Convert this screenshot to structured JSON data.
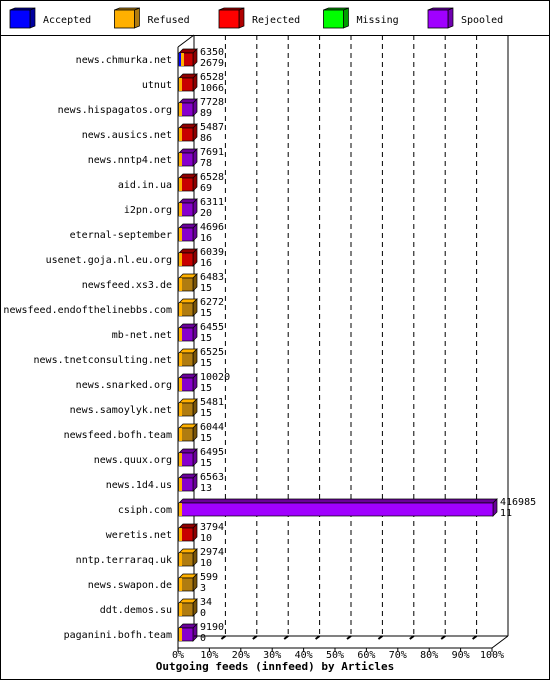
{
  "colors": {
    "accepted": "#0000ff",
    "refused": "#ffb000",
    "refused_dark": "#b07c10",
    "rejected": "#c80000",
    "missing": "#00ff00",
    "spooled": "#8800cc"
  },
  "legend": [
    {
      "key": "accepted",
      "label": "Accepted",
      "color": "#0000ff",
      "side": "#0000a0"
    },
    {
      "key": "refused",
      "label": "Refused",
      "color": "#ffb000",
      "side": "#b07c10"
    },
    {
      "key": "rejected",
      "label": "Rejected",
      "color": "#ff0000",
      "side": "#b00000"
    },
    {
      "key": "missing",
      "label": "Missing",
      "color": "#00ff00",
      "side": "#00a000"
    },
    {
      "key": "spooled",
      "label": "Spooled",
      "color": "#a000ff",
      "side": "#7000b0"
    }
  ],
  "chart_data": {
    "type": "bar",
    "orientation": "horizontal",
    "stacked": true,
    "title": "Outgoing feeds (innfeed) by Articles",
    "x_ticks": [
      "0%",
      "10%",
      "20%",
      "30%",
      "40%",
      "50%",
      "60%",
      "70%",
      "80%",
      "90%",
      "100%"
    ],
    "xlim": [
      0,
      100
    ],
    "grid": true,
    "legend_position": "top",
    "max_offered": 416985,
    "categories": [
      "news.chmurka.net",
      "utnut",
      "news.hispagatos.org",
      "news.ausics.net",
      "news.nntp4.net",
      "aid.in.ua",
      "i2pn.org",
      "eternal-september",
      "usenet.goja.nl.eu.org",
      "newsfeed.xs3.de",
      "newsfeed.endofthelinebbs.com",
      "mb-net.net",
      "news.tnetconsulting.net",
      "news.snarked.org",
      "news.samoylyk.net",
      "newsfeed.bofh.team",
      "news.quux.org",
      "news.1d4.us",
      "csiph.com",
      "weretis.net",
      "nntp.terraraq.uk",
      "news.swapon.de",
      "ddt.demos.su",
      "paganini.bofh.team"
    ],
    "offered": [
      6350,
      6528,
      7728,
      5487,
      7691,
      6528,
      6311,
      4696,
      6039,
      6483,
      6272,
      6455,
      6525,
      10020,
      5481,
      6044,
      6495,
      6563,
      416985,
      3794,
      2974,
      599,
      34,
      9190
    ],
    "accepted": [
      2679,
      1066,
      89,
      86,
      78,
      69,
      20,
      16,
      16,
      15,
      15,
      15,
      15,
      15,
      15,
      15,
      15,
      13,
      11,
      10,
      10,
      3,
      0,
      0
    ],
    "dominant": [
      "rejected",
      "rejected",
      "spooled",
      "rejected",
      "spooled",
      "rejected",
      "spooled",
      "spooled",
      "rejected",
      "refused",
      "refused",
      "spooled",
      "refused",
      "spooled",
      "refused",
      "refused",
      "spooled",
      "spooled",
      "spooled",
      "rejected",
      "refused",
      "refused",
      "refused",
      "spooled"
    ]
  }
}
